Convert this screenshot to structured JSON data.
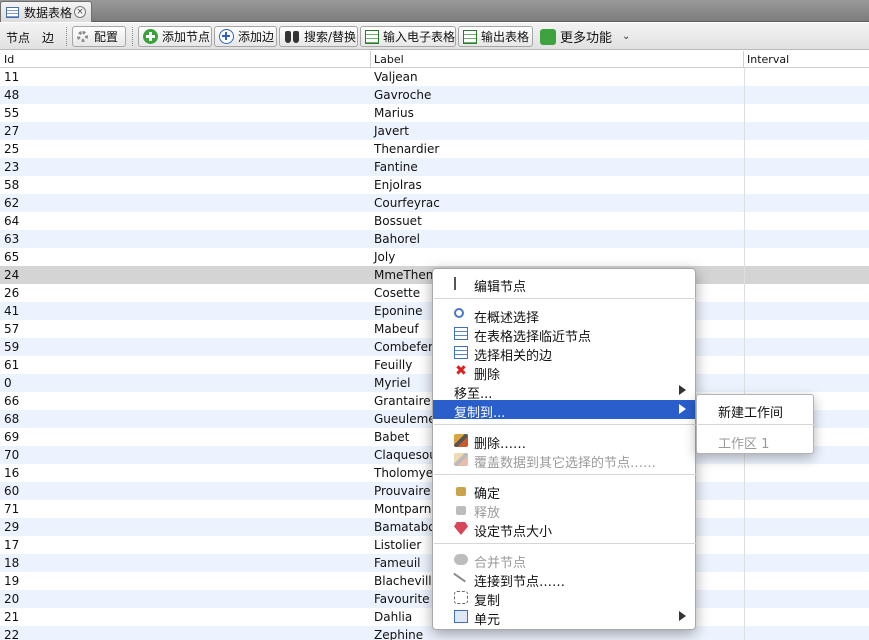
{
  "window": {
    "tab_label": "数据表格",
    "tab_close": "×"
  },
  "toolbar": {
    "nodes_tab": "节点",
    "edges_tab": "边",
    "config_label": "配置",
    "add_node_label": "添加节点",
    "add_edge_label": "添加边",
    "search_replace_label": "搜索/替换",
    "import_label": "输入电子表格",
    "export_label": "输出表格",
    "more_label": "更多功能",
    "more_chevron": "⌄"
  },
  "table": {
    "columns": [
      "Id",
      "Label",
      "Interval"
    ],
    "rows": [
      {
        "id": "11",
        "label": "Valjean"
      },
      {
        "id": "48",
        "label": "Gavroche"
      },
      {
        "id": "55",
        "label": "Marius"
      },
      {
        "id": "27",
        "label": "Javert"
      },
      {
        "id": "25",
        "label": "Thenardier"
      },
      {
        "id": "23",
        "label": "Fantine"
      },
      {
        "id": "58",
        "label": "Enjolras"
      },
      {
        "id": "62",
        "label": "Courfeyrac"
      },
      {
        "id": "64",
        "label": "Bossuet"
      },
      {
        "id": "63",
        "label": "Bahorel"
      },
      {
        "id": "65",
        "label": "Joly"
      },
      {
        "id": "24",
        "label": "MmeThenardier"
      },
      {
        "id": "26",
        "label": "Cosette"
      },
      {
        "id": "41",
        "label": "Eponine"
      },
      {
        "id": "57",
        "label": "Mabeuf"
      },
      {
        "id": "59",
        "label": "Combeferre"
      },
      {
        "id": "61",
        "label": "Feuilly"
      },
      {
        "id": "0",
        "label": "Myriel"
      },
      {
        "id": "66",
        "label": "Grantaire"
      },
      {
        "id": "68",
        "label": "Gueulemer"
      },
      {
        "id": "69",
        "label": "Babet"
      },
      {
        "id": "70",
        "label": "Claquesous"
      },
      {
        "id": "16",
        "label": "Tholomyes"
      },
      {
        "id": "60",
        "label": "Prouvaire"
      },
      {
        "id": "71",
        "label": "Montparnasse"
      },
      {
        "id": "29",
        "label": "Bamatabois"
      },
      {
        "id": "17",
        "label": "Listolier"
      },
      {
        "id": "18",
        "label": "Fameuil"
      },
      {
        "id": "19",
        "label": "Blacheville"
      },
      {
        "id": "20",
        "label": "Favourite"
      },
      {
        "id": "21",
        "label": "Dahlia"
      },
      {
        "id": "22",
        "label": "Zephine"
      }
    ],
    "selected_row_id": "24"
  },
  "context_menu": {
    "edit_node": "编辑节点",
    "select_in_overview": "在概述选择",
    "select_neighbors_in_table": "在表格选择临近节点",
    "select_related_edges": "选择相关的边",
    "delete": "删除",
    "move_to": "移至...",
    "copy_to": "复制到...",
    "clear": "删除……",
    "overwrite_other_selected": "覆盖数据到其它选择的节点……",
    "fix": "确定",
    "release": "释放",
    "set_node_size": "设定节点大小",
    "merge_nodes": "合并节点",
    "link_to_node": "连接到节点……",
    "duplicate": "复制",
    "cell": "单元"
  },
  "submenu": {
    "new_workspace": "新建工作间",
    "workspace_1": "工作区 1"
  }
}
